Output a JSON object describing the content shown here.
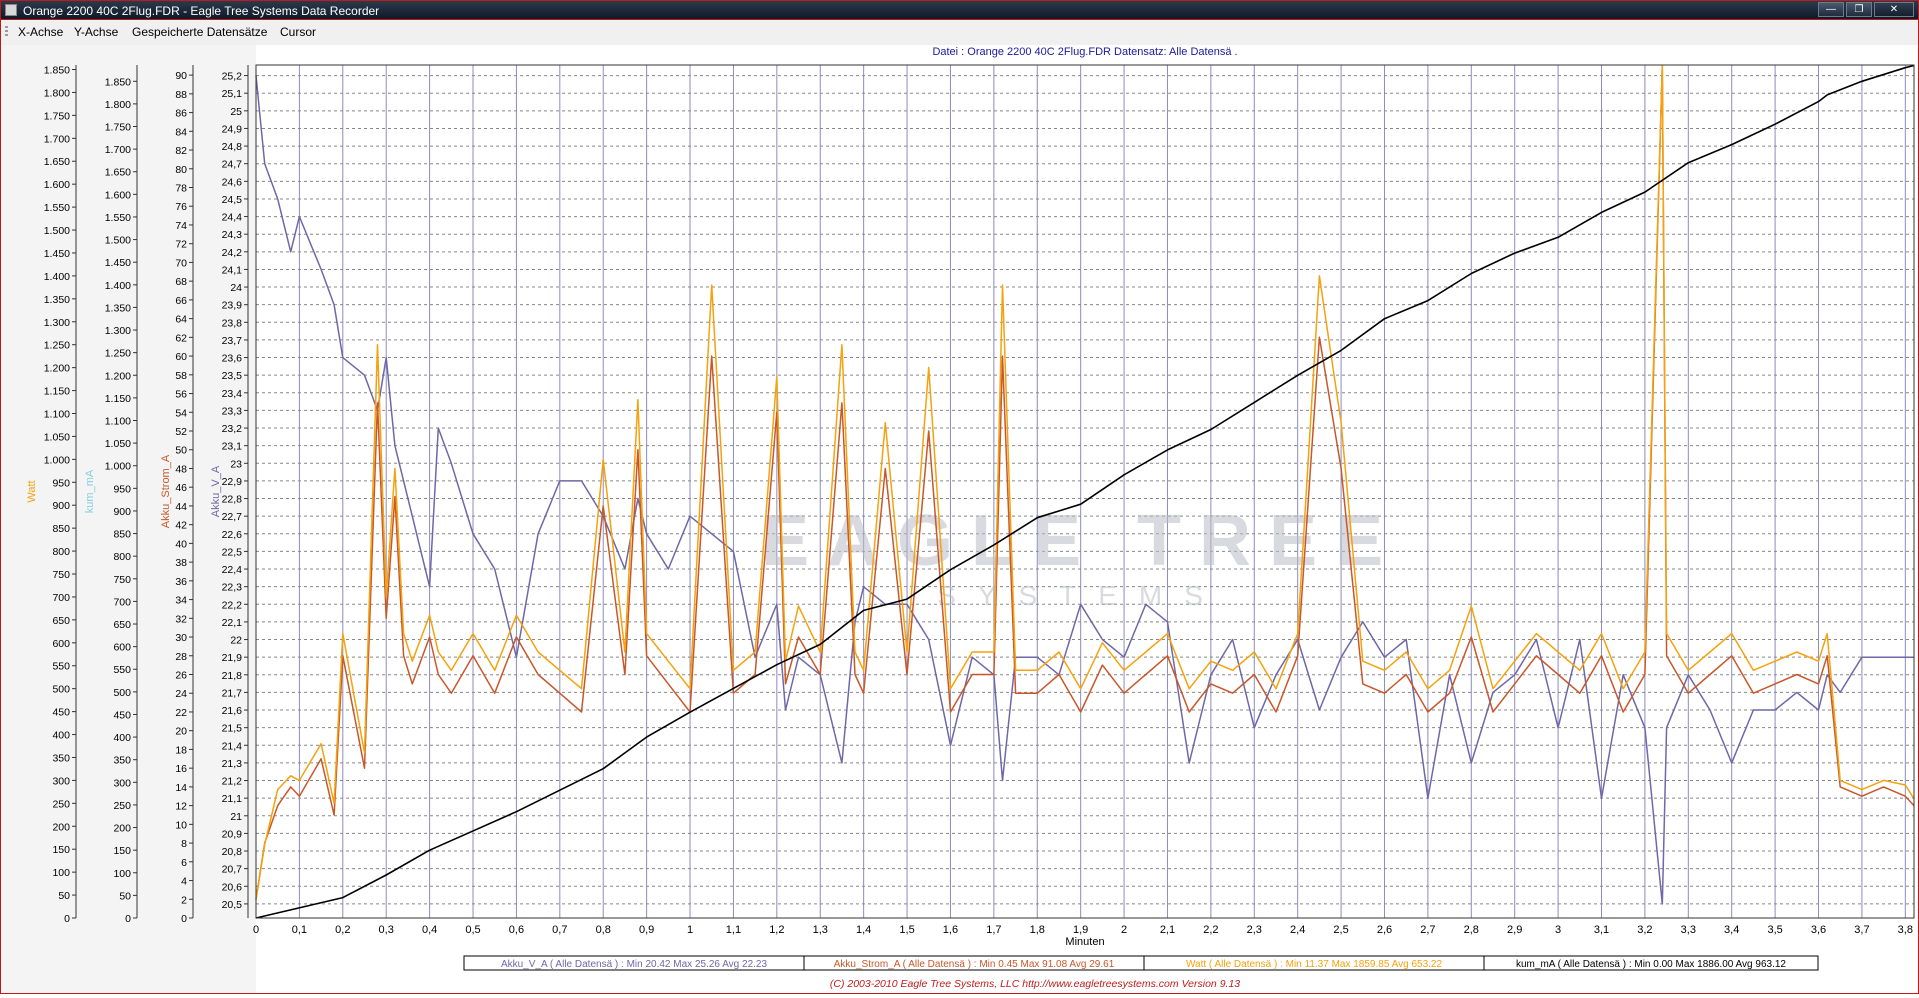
{
  "window": {
    "title": "Orange 2200 40C 2Flug.FDR - Eagle Tree Systems Data Recorder",
    "min_glyph": "—",
    "max_glyph": "❐",
    "close_glyph": "✕"
  },
  "menu": {
    "x_axis": "X-Achse",
    "y_axis": "Y-Achse",
    "saved": "Gespeicherte Datensätze",
    "cursor": "Cursor"
  },
  "chart_data": {
    "type": "line",
    "title": "Datei : Orange 2200 40C 2Flug.FDR   Datensatz: Alle Datensä .",
    "xlabel": "Minuten",
    "xlim": [
      0,
      3.82
    ],
    "x_ticks": [
      0,
      0.1,
      0.2,
      0.3,
      0.4,
      0.5,
      0.6,
      0.7,
      0.8,
      0.9,
      1,
      1.1,
      1.2,
      1.3,
      1.4,
      1.5,
      1.6,
      1.7,
      1.8,
      1.9,
      2,
      2.1,
      2.2,
      2.3,
      2.4,
      2.5,
      2.6,
      2.7,
      2.8,
      2.9,
      3,
      3.1,
      3.2,
      3.3,
      3.4,
      3.5,
      3.6,
      3.7,
      3.8
    ],
    "x_tick_labels": [
      "0",
      "0,1",
      "0,2",
      "0,3",
      "0,4",
      "0,5",
      "0,6",
      "0,7",
      "0,8",
      "0,9",
      "1",
      "1,1",
      "1,2",
      "1,3",
      "1,4",
      "1,5",
      "1,6",
      "1,7",
      "1,8",
      "1,9",
      "2",
      "2,1",
      "2,2",
      "2,3",
      "2,4",
      "2,5",
      "2,6",
      "2,7",
      "2,8",
      "2,9",
      "3",
      "3,1",
      "3,2",
      "3,3",
      "3,4",
      "3,5",
      "3,6",
      "3,7",
      "3,8"
    ],
    "grid": true,
    "colors": {
      "volt": "#6f67a8",
      "current": "#c8572a",
      "watt": "#f5a20d",
      "mah": "#000000",
      "grid_v": "#8c8cbf",
      "grid_h": "#888888",
      "watermark": "#b9bdc8",
      "footer": "#c41c1c",
      "title": "#1a1a9c"
    },
    "axes": {
      "watt": {
        "label": "Watt",
        "ylim": [
          0,
          1859.85
        ],
        "tick_labels": [
          "0",
          "50",
          "100",
          "150",
          "200",
          "250",
          "300",
          "350",
          "400",
          "450",
          "500",
          "550",
          "600",
          "650",
          "700",
          "750",
          "800",
          "850",
          "900",
          "950",
          "1.000",
          "1.050",
          "1.100",
          "1.150",
          "1.200",
          "1.250",
          "1.300",
          "1.350",
          "1.400",
          "1.450",
          "1.500",
          "1.550",
          "1.600",
          "1.650",
          "1.700",
          "1.750",
          "1.800",
          "1.850"
        ]
      },
      "mah": {
        "label": "kum_mA",
        "ylim": [
          0,
          1886
        ],
        "tick_labels": [
          "0",
          "50",
          "100",
          "150",
          "200",
          "250",
          "300",
          "350",
          "400",
          "450",
          "500",
          "550",
          "600",
          "650",
          "700",
          "750",
          "800",
          "850",
          "900",
          "950",
          "1.000",
          "1.050",
          "1.100",
          "1.150",
          "1.200",
          "1.250",
          "1.300",
          "1.350",
          "1.400",
          "1.450",
          "1.500",
          "1.550",
          "1.600",
          "1.650",
          "1.700",
          "1.750",
          "1.800",
          "1.850"
        ]
      },
      "current": {
        "label": "Akku_Strom_A",
        "ylim": [
          0,
          91.08
        ],
        "tick_labels": [
          "0",
          "2",
          "4",
          "6",
          "8",
          "10",
          "12",
          "14",
          "16",
          "18",
          "20",
          "22",
          "24",
          "26",
          "28",
          "30",
          "32",
          "34",
          "36",
          "38",
          "40",
          "42",
          "44",
          "46",
          "48",
          "50",
          "52",
          "54",
          "56",
          "58",
          "60",
          "62",
          "64",
          "66",
          "68",
          "70",
          "72",
          "74",
          "76",
          "78",
          "80",
          "82",
          "84",
          "86",
          "88",
          "90"
        ]
      },
      "volt": {
        "label": "Akku_V_A",
        "ylim": [
          20.42,
          25.26
        ],
        "tick_labels": [
          "20,5",
          "20,6",
          "20,7",
          "20,8",
          "20,9",
          "21",
          "21,1",
          "21,2",
          "21,3",
          "21,4",
          "21,5",
          "21,6",
          "21,7",
          "21,8",
          "21,9",
          "22",
          "22,1",
          "22,2",
          "22,3",
          "22,4",
          "22,5",
          "22,6",
          "22,7",
          "22,8",
          "22,9",
          "23",
          "23,1",
          "23,2",
          "23,3",
          "23,4",
          "23,5",
          "23,6",
          "23,7",
          "23,8",
          "23,9",
          "24",
          "24,1",
          "24,2",
          "24,3",
          "24,4",
          "24,5",
          "24,6",
          "24,7",
          "24,8",
          "24,9",
          "25",
          "25,1",
          "25,2"
        ]
      }
    },
    "series": [
      {
        "name": "Akku_V_A",
        "legend": "Akku_V_A ( Alle Datensä ) : Min 20.42   Max 25.26   Avg 22.23",
        "x": [
          0,
          0.02,
          0.05,
          0.08,
          0.1,
          0.15,
          0.18,
          0.2,
          0.25,
          0.28,
          0.3,
          0.32,
          0.34,
          0.36,
          0.4,
          0.42,
          0.45,
          0.5,
          0.55,
          0.6,
          0.65,
          0.7,
          0.75,
          0.8,
          0.85,
          0.88,
          0.9,
          0.95,
          1,
          1.05,
          1.1,
          1.15,
          1.2,
          1.22,
          1.25,
          1.3,
          1.35,
          1.38,
          1.4,
          1.45,
          1.5,
          1.55,
          1.6,
          1.65,
          1.7,
          1.72,
          1.75,
          1.8,
          1.85,
          1.9,
          1.95,
          2,
          2.05,
          2.1,
          2.15,
          2.2,
          2.25,
          2.3,
          2.35,
          2.4,
          2.45,
          2.5,
          2.55,
          2.6,
          2.65,
          2.7,
          2.75,
          2.8,
          2.85,
          2.9,
          2.95,
          3,
          3.05,
          3.1,
          3.15,
          3.2,
          3.24,
          3.25,
          3.3,
          3.35,
          3.4,
          3.45,
          3.5,
          3.55,
          3.6,
          3.62,
          3.65,
          3.7,
          3.75,
          3.8,
          3.82
        ],
        "y": [
          25.2,
          24.7,
          24.5,
          24.2,
          24.4,
          24.1,
          23.9,
          23.6,
          23.5,
          23.3,
          23.6,
          23.1,
          22.9,
          22.7,
          22.3,
          23.2,
          23,
          22.6,
          22.4,
          21.9,
          22.6,
          22.9,
          22.9,
          22.7,
          22.4,
          22.8,
          22.6,
          22.4,
          22.7,
          22.6,
          22.5,
          21.9,
          22.2,
          21.6,
          21.9,
          21.8,
          21.3,
          22.1,
          22.3,
          22.2,
          22.2,
          22,
          21.4,
          21.9,
          21.8,
          21.2,
          21.9,
          21.9,
          21.8,
          22.2,
          22,
          21.9,
          22.2,
          22.1,
          21.3,
          21.8,
          22,
          21.5,
          21.8,
          22,
          21.6,
          21.9,
          22.1,
          21.9,
          22,
          21.1,
          21.8,
          21.3,
          21.7,
          21.8,
          22,
          21.5,
          22,
          21.1,
          21.8,
          21.5,
          20.5,
          21.5,
          21.8,
          21.6,
          21.3,
          21.6,
          21.6,
          21.7,
          21.6,
          21.8,
          21.7,
          21.9,
          21.9,
          21.9,
          21.9
        ]
      },
      {
        "name": "Akku_Strom_A",
        "legend": "Akku_Strom_A ( Alle Datensä ) : Min 0.45   Max 91.08   Avg 29.61",
        "x": [
          0,
          0.02,
          0.05,
          0.08,
          0.1,
          0.15,
          0.18,
          0.2,
          0.25,
          0.28,
          0.3,
          0.32,
          0.34,
          0.36,
          0.4,
          0.42,
          0.45,
          0.5,
          0.55,
          0.6,
          0.65,
          0.7,
          0.75,
          0.8,
          0.85,
          0.88,
          0.9,
          0.95,
          1,
          1.05,
          1.1,
          1.15,
          1.2,
          1.22,
          1.25,
          1.3,
          1.35,
          1.38,
          1.4,
          1.45,
          1.5,
          1.55,
          1.6,
          1.65,
          1.7,
          1.72,
          1.75,
          1.8,
          1.85,
          1.9,
          1.95,
          2,
          2.05,
          2.1,
          2.15,
          2.2,
          2.25,
          2.3,
          2.35,
          2.4,
          2.45,
          2.5,
          2.55,
          2.6,
          2.65,
          2.7,
          2.75,
          2.8,
          2.85,
          2.9,
          2.95,
          3,
          3.05,
          3.1,
          3.15,
          3.2,
          3.24,
          3.25,
          3.3,
          3.35,
          3.4,
          3.45,
          3.5,
          3.55,
          3.6,
          3.62,
          3.65,
          3.7,
          3.75,
          3.8,
          3.82
        ],
        "y": [
          2,
          8,
          12,
          14,
          13,
          17,
          11,
          28,
          16,
          55,
          32,
          45,
          28,
          25,
          30,
          26,
          24,
          28,
          24,
          30,
          26,
          24,
          22,
          44,
          26,
          50,
          28,
          25,
          22,
          60,
          24,
          26,
          54,
          25,
          30,
          26,
          55,
          26,
          24,
          48,
          26,
          52,
          22,
          26,
          26,
          60,
          24,
          24,
          26,
          22,
          27,
          24,
          26,
          28,
          22,
          25,
          24,
          26,
          22,
          28,
          62,
          48,
          25,
          24,
          26,
          22,
          24,
          30,
          22,
          25,
          28,
          26,
          24,
          28,
          22,
          26,
          91,
          28,
          24,
          26,
          28,
          24,
          25,
          26,
          25,
          28,
          14,
          13,
          14,
          13,
          12
        ]
      },
      {
        "name": "Watt",
        "legend": "Watt ( Alle Datensä ) : Min 11.37   Max 1859.85   Avg 653.22",
        "x": [
          0,
          0.02,
          0.05,
          0.08,
          0.1,
          0.15,
          0.18,
          0.2,
          0.25,
          0.28,
          0.3,
          0.32,
          0.34,
          0.36,
          0.4,
          0.42,
          0.45,
          0.5,
          0.55,
          0.6,
          0.65,
          0.7,
          0.75,
          0.8,
          0.85,
          0.88,
          0.9,
          0.95,
          1,
          1.05,
          1.1,
          1.15,
          1.2,
          1.22,
          1.25,
          1.3,
          1.35,
          1.38,
          1.4,
          1.45,
          1.5,
          1.55,
          1.6,
          1.65,
          1.7,
          1.72,
          1.75,
          1.8,
          1.85,
          1.9,
          1.95,
          2,
          2.05,
          2.1,
          2.15,
          2.2,
          2.25,
          2.3,
          2.35,
          2.4,
          2.45,
          2.5,
          2.55,
          2.6,
          2.65,
          2.7,
          2.75,
          2.8,
          2.85,
          2.9,
          2.95,
          3,
          3.05,
          3.1,
          3.15,
          3.2,
          3.24,
          3.25,
          3.3,
          3.35,
          3.4,
          3.45,
          3.5,
          3.55,
          3.6,
          3.62,
          3.65,
          3.7,
          3.75,
          3.8,
          3.82
        ],
        "y": [
          40,
          160,
          280,
          310,
          300,
          380,
          250,
          620,
          360,
          1250,
          700,
          980,
          620,
          560,
          660,
          580,
          540,
          620,
          540,
          660,
          580,
          540,
          500,
          1000,
          580,
          1130,
          620,
          560,
          500,
          1380,
          540,
          580,
          1180,
          560,
          680,
          580,
          1250,
          580,
          540,
          1080,
          580,
          1200,
          500,
          580,
          580,
          1380,
          540,
          540,
          580,
          500,
          600,
          540,
          580,
          620,
          500,
          560,
          540,
          580,
          500,
          620,
          1400,
          1080,
          560,
          540,
          580,
          500,
          540,
          680,
          500,
          560,
          620,
          580,
          540,
          620,
          500,
          580,
          1859,
          620,
          540,
          580,
          620,
          540,
          560,
          580,
          560,
          620,
          300,
          280,
          300,
          290,
          260
        ]
      },
      {
        "name": "kum_mA",
        "legend": "kum_mA ( Alle Datensä ) : Min 0.00   Max 1886.00   Avg 963.12",
        "x": [
          0,
          0.2,
          0.3,
          0.4,
          0.6,
          0.8,
          0.9,
          1,
          1.2,
          1.3,
          1.4,
          1.5,
          1.6,
          1.7,
          1.8,
          1.9,
          2,
          2.1,
          2.2,
          2.3,
          2.4,
          2.5,
          2.6,
          2.7,
          2.8,
          2.9,
          3,
          3.1,
          3.2,
          3.3,
          3.4,
          3.5,
          3.6,
          3.62,
          3.7,
          3.8,
          3.82
        ],
        "y": [
          0,
          90,
          190,
          300,
          470,
          660,
          800,
          910,
          1120,
          1210,
          1360,
          1410,
          1540,
          1650,
          1770,
          1830,
          1960,
          2070,
          2160,
          2280,
          2400,
          2510,
          2650,
          2730,
          2850,
          2940,
          3010,
          3120,
          3210,
          3340,
          3420,
          3510,
          3610,
          3640,
          3700,
          3760,
          3770
        ],
        "y_scale": 0.5
      }
    ],
    "watermark": {
      "brand": "EAGLE TREE",
      "sub": "SYSTEMS"
    },
    "footer": "(C) 2003-2010 Eagle Tree Systems, LLC      http://www.eagletreesystems.com     Version 9.13"
  }
}
